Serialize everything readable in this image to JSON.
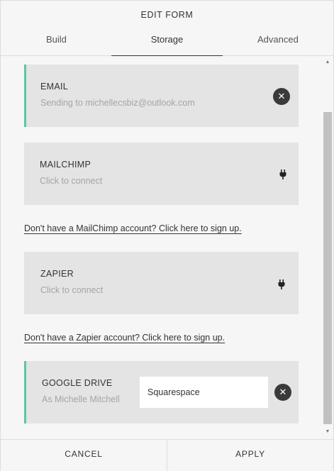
{
  "header": {
    "title": "EDIT FORM",
    "tabs": [
      "Build",
      "Storage",
      "Advanced"
    ]
  },
  "storage": {
    "email": {
      "title": "EMAIL",
      "subtitle": "Sending to michellecsbiz@outlook.com",
      "action_icon": "close-icon"
    },
    "mailchimp": {
      "title": "MAILCHIMP",
      "subtitle": "Click to connect",
      "action_icon": "plug-icon",
      "signup_link": "Don't have a MailChimp account? Click here to sign up."
    },
    "zapier": {
      "title": "ZAPIER",
      "subtitle": "Click to connect",
      "action_icon": "plug-icon",
      "signup_link": "Don't have a Zapier account? Click here to sign up."
    },
    "google_drive": {
      "title": "GOOGLE DRIVE",
      "subtitle": "As Michelle Mitchell",
      "folder_value": "Squarespace",
      "action_icon": "close-icon"
    }
  },
  "footer": {
    "cancel_label": "CANCEL",
    "apply_label": "APPLY"
  },
  "colors": {
    "active_accent": "#5ac8a0",
    "card_background": "#e4e4e4"
  }
}
